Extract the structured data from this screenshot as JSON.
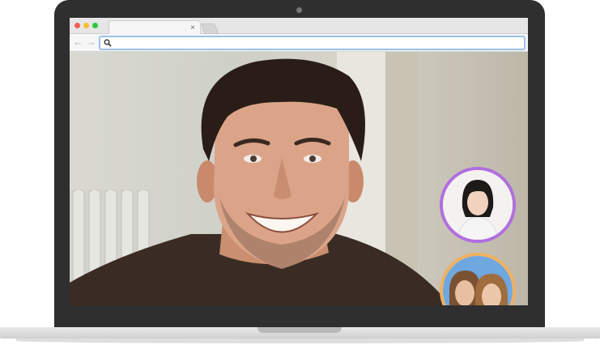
{
  "browser": {
    "tab": {
      "title": "",
      "close_glyph": "×"
    },
    "nav": {
      "back_glyph": "←",
      "forward_glyph": "→"
    },
    "address_bar": {
      "value": ""
    }
  },
  "call": {
    "participants": [
      {
        "role": "main-speaker"
      },
      {
        "role": "participant",
        "ring_color": "#b06fe0"
      },
      {
        "role": "participant",
        "ring_color": "#f0b060"
      }
    ]
  },
  "colors": {
    "traffic_red": "#f25f57",
    "traffic_yellow": "#f8bd2e",
    "traffic_green": "#2bc840",
    "address_focus": "#9cc1ea",
    "laptop_bezel": "#2f2f2f"
  },
  "icons": [
    "search-icon",
    "back-arrow-icon",
    "forward-arrow-icon",
    "close-icon",
    "camera-icon"
  ]
}
